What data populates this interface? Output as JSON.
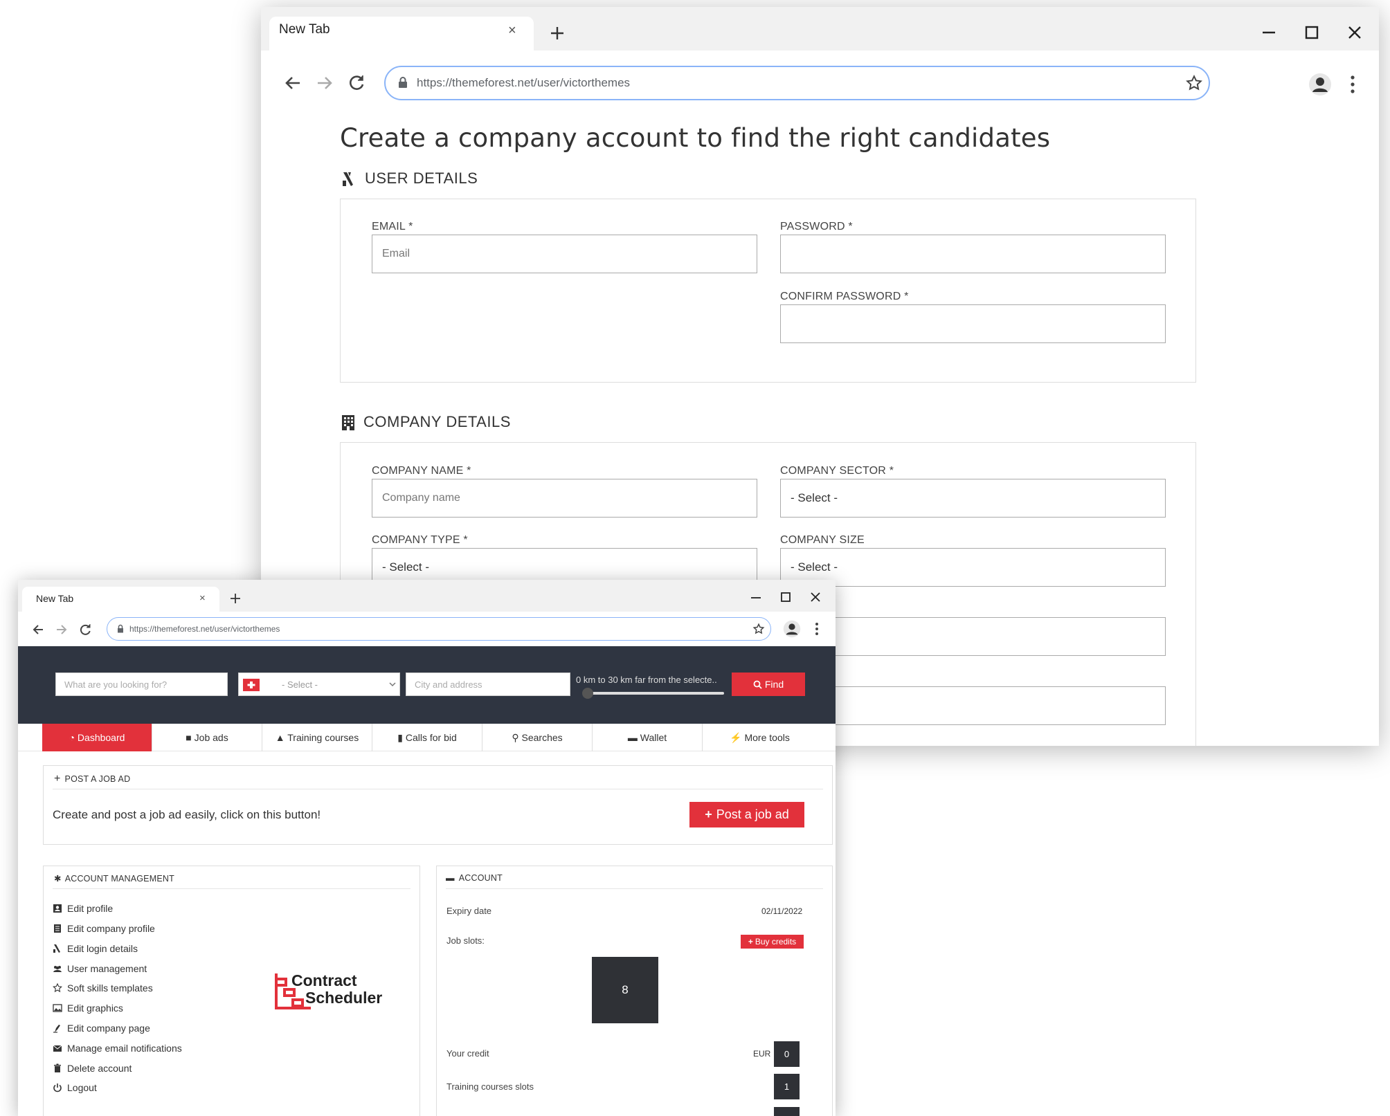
{
  "back_window": {
    "tab_title": "New Tab",
    "tab_close": "×",
    "url": "https://themeforest.net/user/victorthemes",
    "page_title": "Create a company account to find the right candidates",
    "user_details": {
      "heading": "USER DETAILS",
      "email_label": "EMAIL *",
      "email_placeholder": "Email",
      "password_label": "PASSWORD *",
      "confirm_password_label": "CONFIRM PASSWORD *"
    },
    "company_details": {
      "heading": "COMPANY DETAILS",
      "company_name_label": "COMPANY NAME *",
      "company_name_placeholder": "Company name",
      "company_sector_label": "COMPANY SECTOR *",
      "company_sector_value": "- Select -",
      "company_type_label": "COMPANY TYPE *",
      "company_type_value": "- Select -",
      "company_size_label": "COMPANY SIZE",
      "company_size_value": "- Select -"
    }
  },
  "front_window": {
    "tab_title": "New Tab",
    "tab_close": "×",
    "url": "https://themeforest.net/user/victorthemes",
    "search": {
      "keyword_placeholder": "What are you looking for?",
      "country_value": "- Select -",
      "city_placeholder": "City and address",
      "range_text": "0 km to 30 km far from the selecte..",
      "find_label": "Find"
    },
    "nav_tabs": [
      {
        "label": "Dashboard",
        "icon": "dashboard-icon",
        "active": true
      },
      {
        "label": "Job ads",
        "icon": "briefcase-icon",
        "active": false
      },
      {
        "label": "Training courses",
        "icon": "graduation-cap-icon",
        "active": false
      },
      {
        "label": "Calls for bid",
        "icon": "thumbs-up-icon",
        "active": false
      },
      {
        "label": "Searches",
        "icon": "search-icon",
        "active": false
      },
      {
        "label": "Wallet",
        "icon": "wallet-icon",
        "active": false
      },
      {
        "label": "More tools",
        "icon": "bolt-icon",
        "active": false
      }
    ],
    "post_job": {
      "heading": "POST A JOB AD",
      "text": "Create and post a job ad easily, click on this button!",
      "button_label": "Post a job ad"
    },
    "account_management": {
      "heading": "ACCOUNT MANAGEMENT",
      "items": [
        {
          "label": "Edit profile",
          "icon": "profile-icon"
        },
        {
          "label": "Edit company profile",
          "icon": "building-icon"
        },
        {
          "label": "Edit login details",
          "icon": "key-icon"
        },
        {
          "label": "User management",
          "icon": "users-icon"
        },
        {
          "label": "Soft skills templates",
          "icon": "star-outline-icon"
        },
        {
          "label": "Edit graphics",
          "icon": "image-icon"
        },
        {
          "label": "Edit company page",
          "icon": "edit-page-icon"
        },
        {
          "label": "Manage email notifications",
          "icon": "email-icon"
        },
        {
          "label": "Delete account",
          "icon": "trash-icon"
        },
        {
          "label": "Logout",
          "icon": "power-icon"
        }
      ],
      "logo_line1": "Contract",
      "logo_line2": "Scheduler"
    },
    "account": {
      "heading": "ACCOUNT",
      "expiry_label": "Expiry date",
      "expiry_value": "02/11/2022",
      "job_slots_label": "Job slots:",
      "buy_credits_label": "Buy credits",
      "job_slots_value": "8",
      "credit_label": "Your credit",
      "credit_currency": "EUR",
      "credit_value": "0",
      "training_slots_label": "Training courses slots",
      "training_slots_value": "1"
    }
  },
  "colors": {
    "accent_red": "#e2313b",
    "dark_header": "#2f3541",
    "omnibox_border": "#8ab4f8"
  }
}
